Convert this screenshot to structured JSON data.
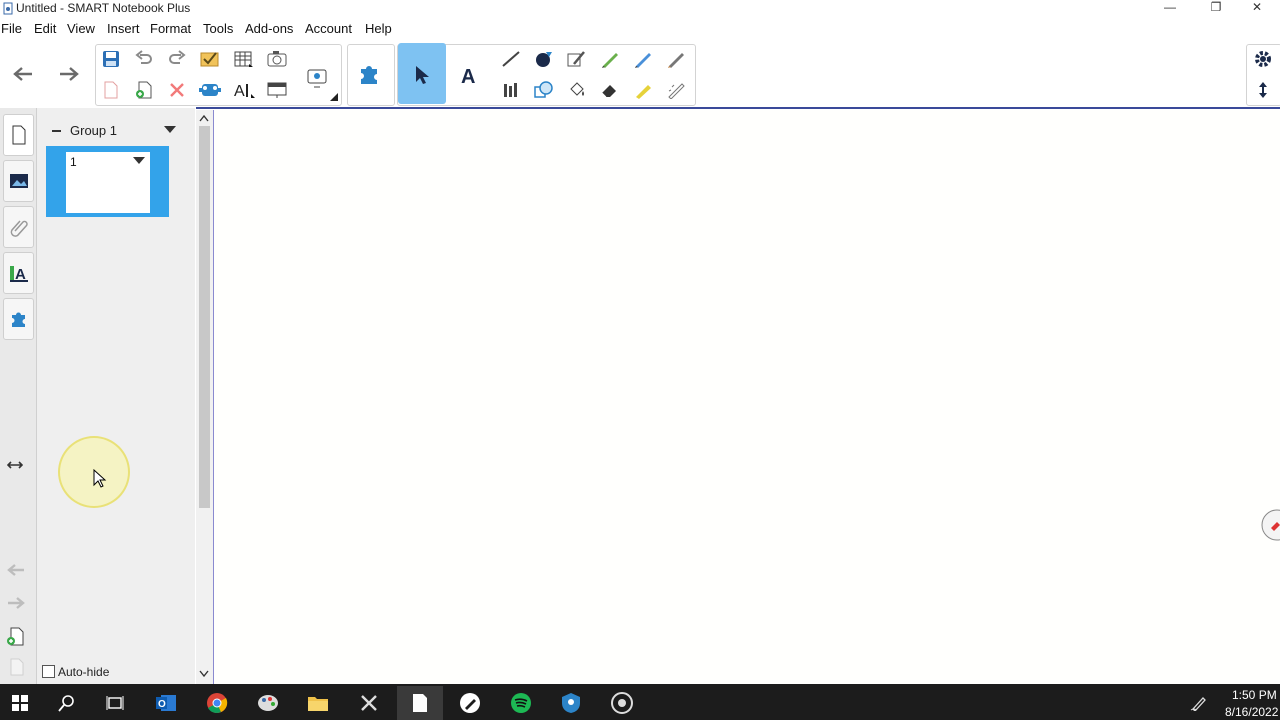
{
  "window": {
    "title": "Untitled - SMART Notebook Plus",
    "minimize": "—",
    "restore": "❐",
    "close": "✕"
  },
  "menu": [
    "File",
    "Edit",
    "View",
    "Insert",
    "Format",
    "Tools",
    "Add-ons",
    "Account",
    "Help"
  ],
  "sorter": {
    "group_label": "Group 1",
    "page_number": "1",
    "autohide_label": "Auto-hide"
  },
  "taskbar": {
    "time": "1:50 PM",
    "date": "8/16/2022"
  },
  "colors": {
    "accent_blue": "#33a3ea",
    "select_tool_bg": "#7ec2f2",
    "taskbar": "#1c1c1c"
  }
}
